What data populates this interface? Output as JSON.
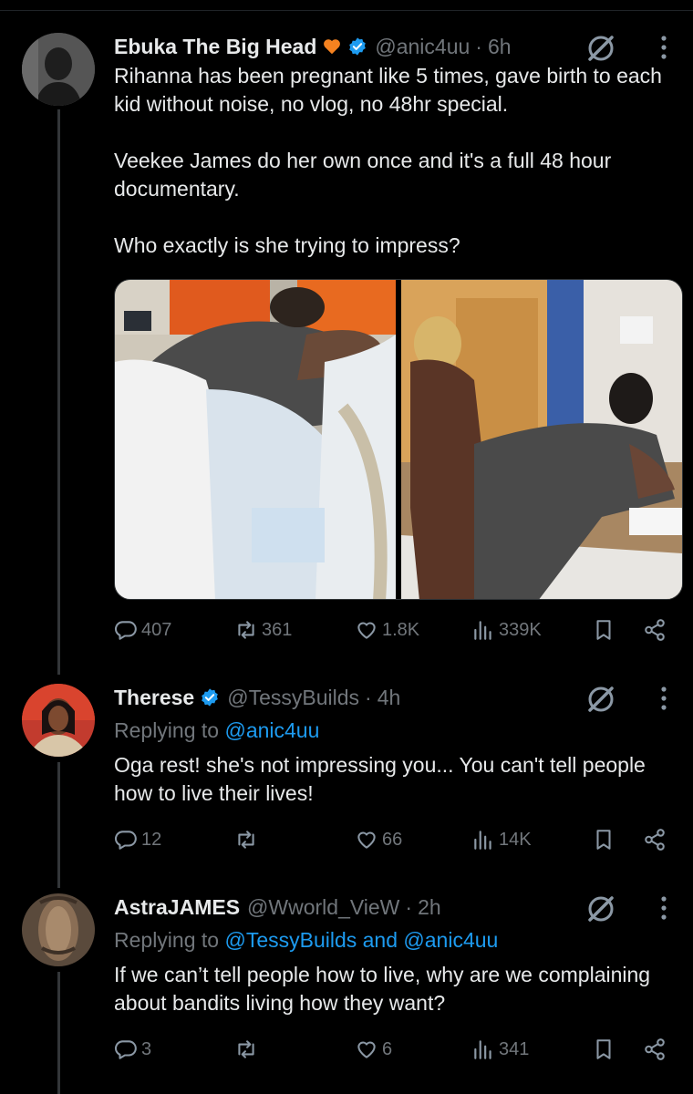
{
  "colors": {
    "background": "#000000",
    "text": "#e7e9ea",
    "muted": "#71767b",
    "link": "#1d9bf0",
    "verified": "#1d9bf0",
    "heart_emoji": "#f58220"
  },
  "posts": [
    {
      "name": "Ebuka The Big Head",
      "handle": "@anic4uu",
      "time": "6h",
      "emoji_icon": "orange-heart-icon",
      "verified": true,
      "paragraphs": [
        "Rihanna has been pregnant like 5 times, gave birth to each kid without noise, no vlog, no 48hr special.",
        "Veekee James do her own once and it's a full 48 hour documentary.",
        "Who exactly is she trying to impress?"
      ],
      "stats": {
        "replies": "407",
        "reposts": "361",
        "likes": "1.8K",
        "views": "339K"
      }
    },
    {
      "name": "Therese",
      "handle": "@TessyBuilds",
      "time": "4h",
      "verified": true,
      "replying_prefix": "Replying to",
      "replying_to": "@anic4uu",
      "text": "Oga rest! she's not impressing you... You can't tell people how to live their lives!",
      "stats": {
        "replies": "12",
        "reposts": "",
        "likes": "66",
        "views": "14K"
      }
    },
    {
      "name": "AstraJAMES",
      "handle": "@Wworld_VieW",
      "time": "2h",
      "verified": false,
      "replying_prefix": "Replying to",
      "replying_to": "@TessyBuilds and @anic4uu",
      "text": "If we can’t tell people how to live, why are we complaining about bandits living how they want?",
      "stats": {
        "replies": "3",
        "reposts": "",
        "likes": "6",
        "views": "341"
      }
    }
  ]
}
